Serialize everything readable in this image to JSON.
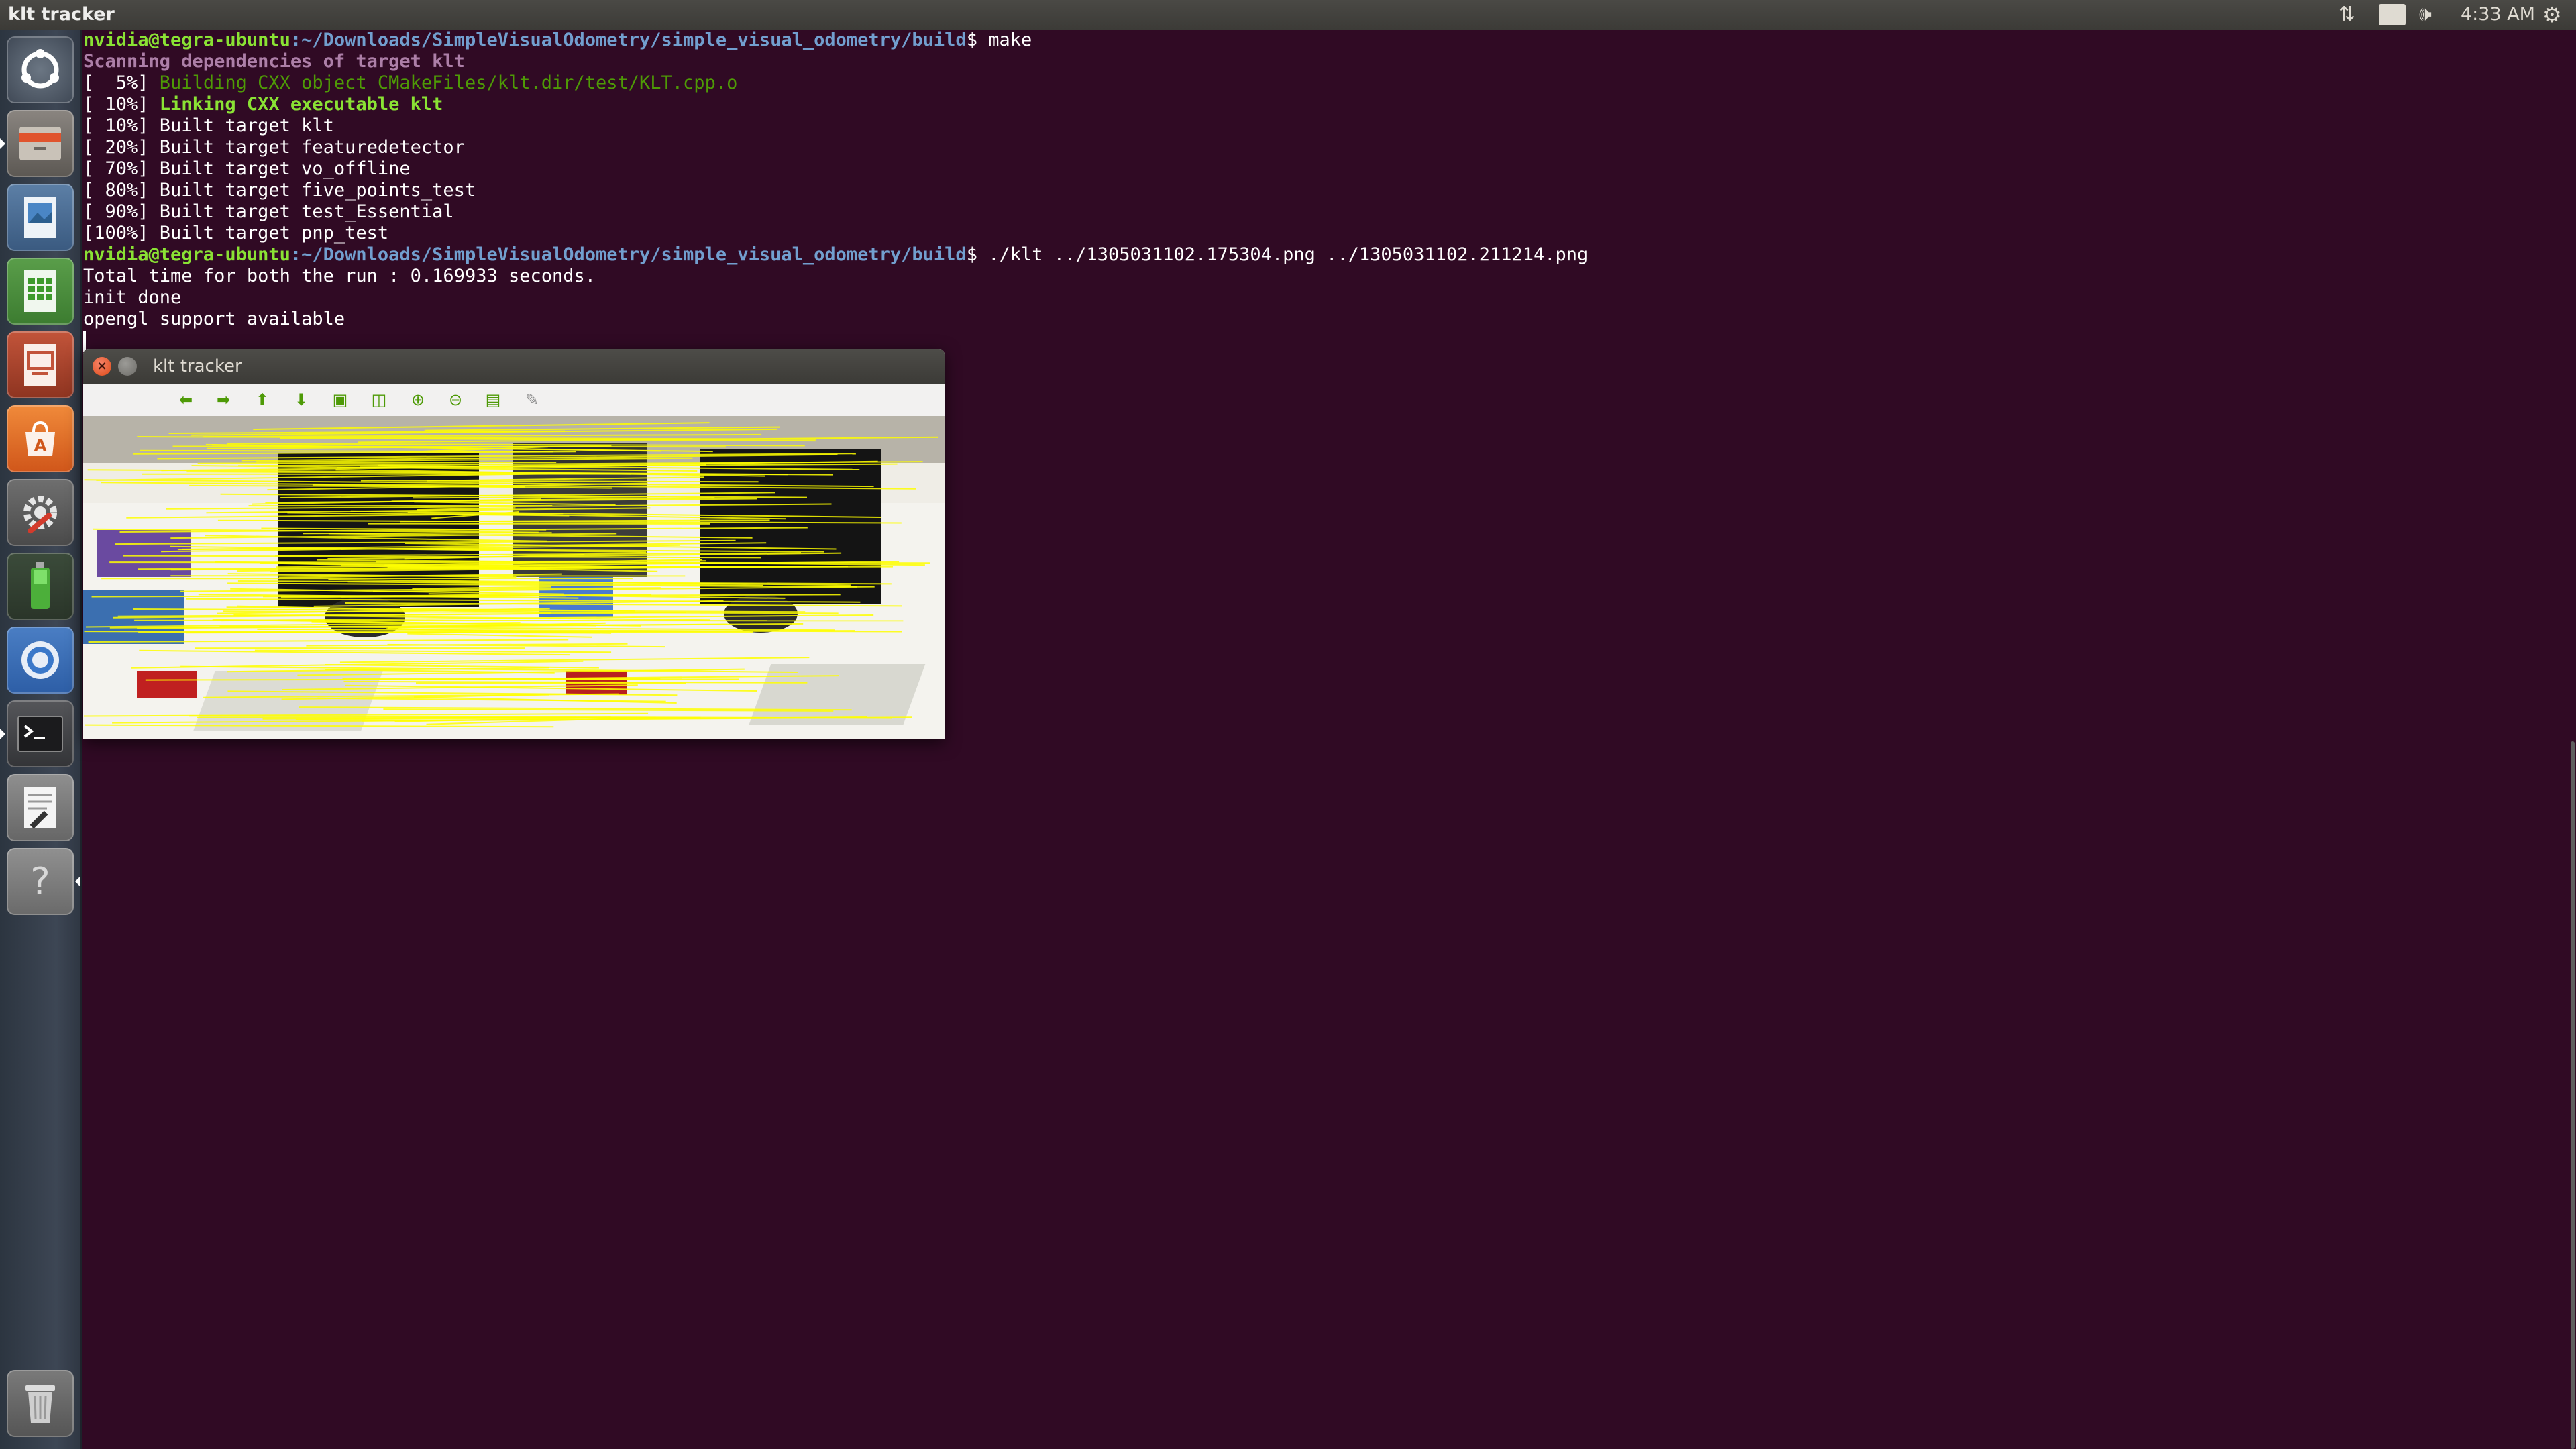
{
  "panel": {
    "app_title": "klt tracker",
    "keyboard_layout": "En",
    "clock": "4:33 AM"
  },
  "launcher": {
    "items": [
      {
        "name": "dash-home-icon"
      },
      {
        "name": "files-icon"
      },
      {
        "name": "image-viewer-icon"
      },
      {
        "name": "spreadsheet-icon"
      },
      {
        "name": "presentation-icon"
      },
      {
        "name": "software-center-icon"
      },
      {
        "name": "system-settings-icon"
      },
      {
        "name": "battery-tool-icon"
      },
      {
        "name": "chromium-icon"
      },
      {
        "name": "terminal-icon"
      },
      {
        "name": "text-editor-icon"
      },
      {
        "name": "help-icon"
      },
      {
        "name": "trash-icon"
      }
    ]
  },
  "terminal": {
    "prompt_user": "nvidia@tegra-ubuntu",
    "prompt_path": ":~/Downloads/SimpleVisualOdometry/simple_visual_odometry/build",
    "cmd_make": "$ make",
    "scan": "Scanning dependencies of target klt",
    "build_prefix": "[  5%] ",
    "build_text": "Building CXX object CMakeFiles/klt.dir/test/KLT.cpp.o",
    "link_prefix": "[ 10%] ",
    "link_text": "Linking CXX executable klt",
    "lines_built": [
      "[ 10%] Built target klt",
      "[ 20%] Built target featuredetector",
      "[ 70%] Built target vo_offline",
      "[ 80%] Built target five_points_test",
      "[ 90%] Built target test_Essential",
      "[100%] Built target pnp_test"
    ],
    "cmd_run": "$ ./klt ../1305031102.175304.png ../1305031102.211214.png",
    "output": [
      "Total time for both the run : 0.169933 seconds.",
      "init done",
      "opengl support available"
    ]
  },
  "klt_window": {
    "title": "klt tracker",
    "toolbar": [
      {
        "name": "pan-left-button",
        "glyph": "⬅"
      },
      {
        "name": "pan-right-button",
        "glyph": "➡"
      },
      {
        "name": "pan-up-button",
        "glyph": "⬆"
      },
      {
        "name": "pan-down-button",
        "glyph": "⬇"
      },
      {
        "name": "zoom-fit-button",
        "glyph": "▣"
      },
      {
        "name": "zoom-original-button",
        "glyph": "◫"
      },
      {
        "name": "zoom-in-button",
        "glyph": "⊕"
      },
      {
        "name": "zoom-out-button",
        "glyph": "⊖"
      },
      {
        "name": "save-image-button",
        "glyph": "▤"
      },
      {
        "name": "properties-button",
        "glyph": "✎"
      }
    ]
  },
  "colors": {
    "terminal_bg": "#300a24",
    "prompt_user": "#8ae234",
    "prompt_path": "#729fcf",
    "track_lines": "#ffff00"
  }
}
